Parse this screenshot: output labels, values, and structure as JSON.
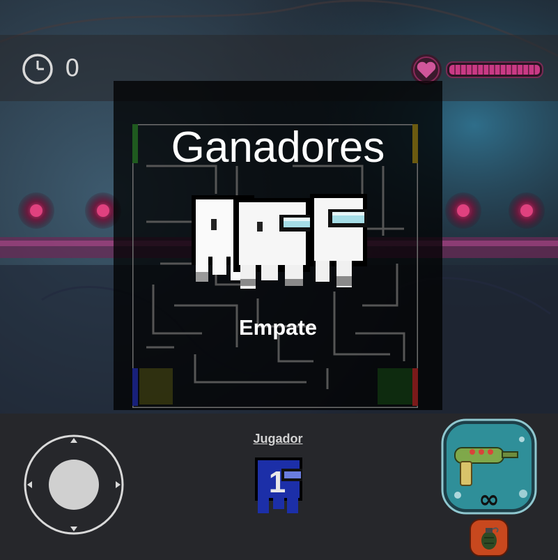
{
  "hud": {
    "timer_value": "0",
    "timer_icon": "clock-icon",
    "health_icon": "heart-icon",
    "health_fraction": 1.0
  },
  "results": {
    "title": "Ganadores",
    "outcome": "Empate"
  },
  "player": {
    "label": "Jugador",
    "number": "1"
  },
  "weapon": {
    "ammo": "∞",
    "icon": "ray-gun-icon"
  },
  "grenade": {
    "icon": "grenade-icon"
  },
  "colors": {
    "corner_green": "#1f5a1f",
    "corner_yellow": "#6b5a10",
    "corner_blue": "#18207a",
    "corner_red": "#7a1a1a",
    "player_blue": "#1c2fa8",
    "weapon_teal": "#2f8f99",
    "health_pink": "#c93a85"
  }
}
